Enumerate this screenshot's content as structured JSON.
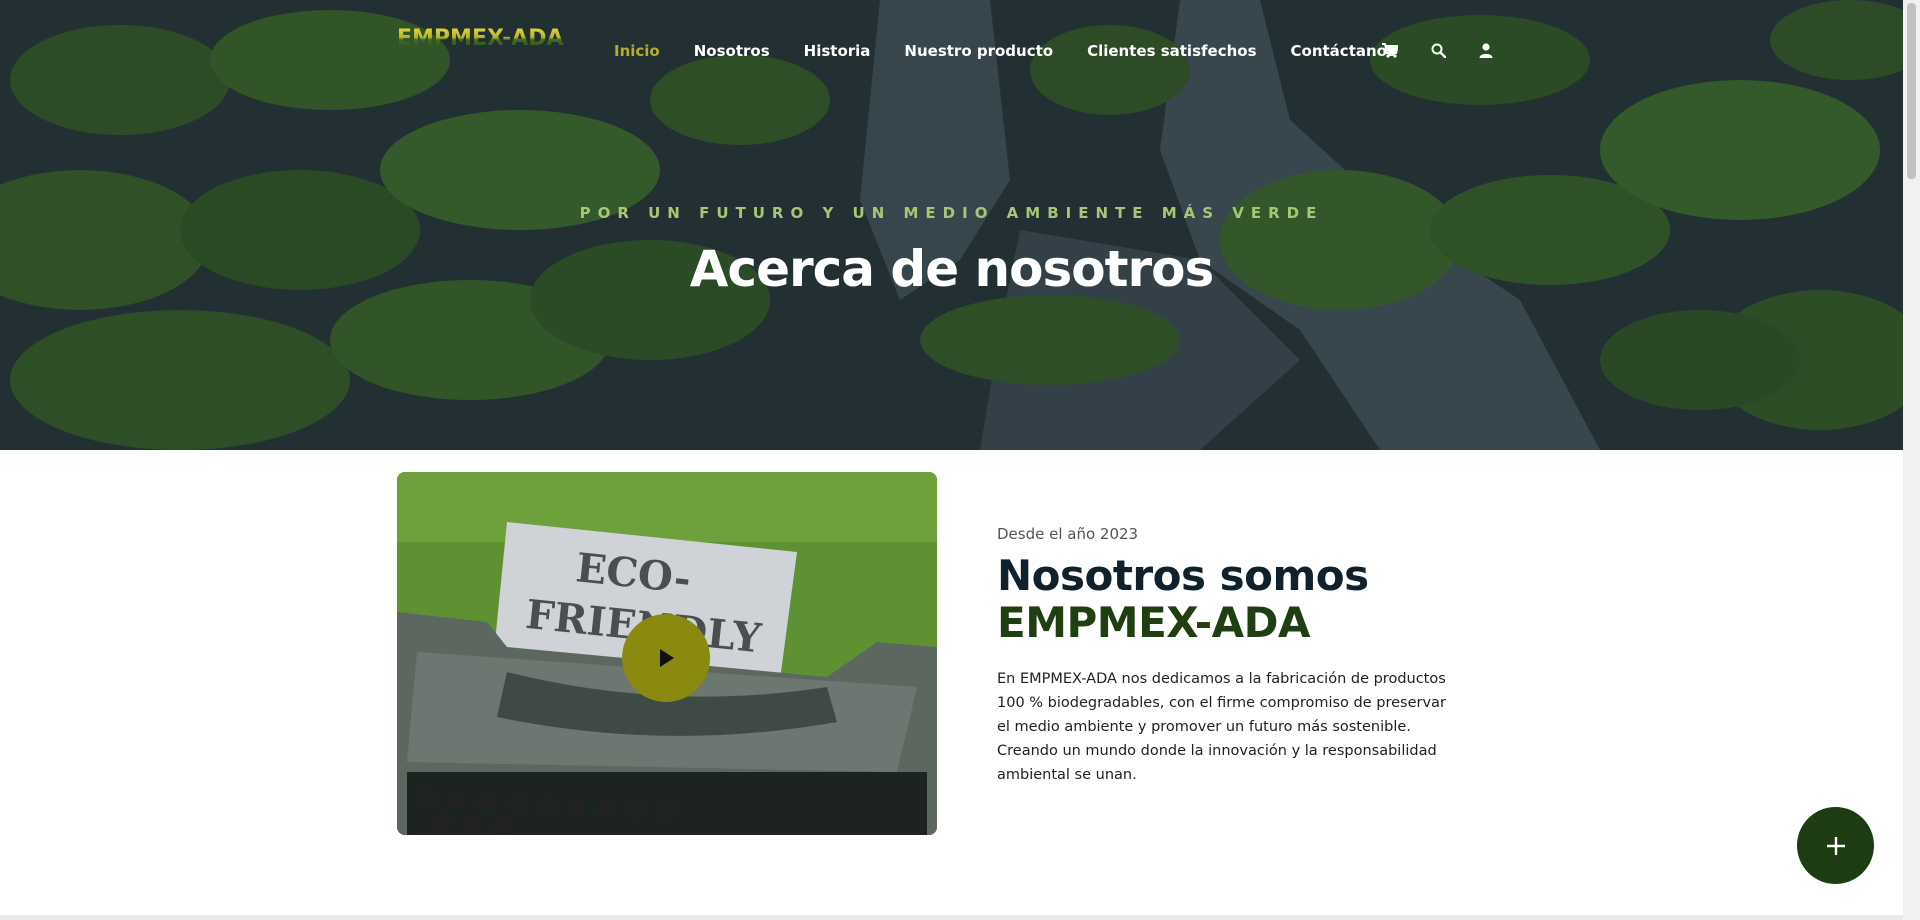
{
  "brand": {
    "logo_text": "EMPMEX-ADA"
  },
  "nav": {
    "items": [
      {
        "label": "Inicio",
        "active": true
      },
      {
        "label": "Nosotros"
      },
      {
        "label": "Historia"
      },
      {
        "label": "Nuestro producto"
      },
      {
        "label": "Clientes satisfechos"
      },
      {
        "label": "Contáctanos"
      }
    ],
    "icons": [
      "cart-icon",
      "search-icon",
      "user-icon"
    ]
  },
  "hero": {
    "kicker": "POR UN FUTURO Y UN MEDIO AMBIENTE MÁS VERDE",
    "title": "Acerca de nosotros"
  },
  "about": {
    "since": "Desde el año 2023",
    "heading_line1": "Nosotros somos",
    "heading_brand": "EMPMEX-ADA",
    "paragraph": "En EMPMEX-ADA nos dedicamos a la fabricación de productos 100 % biodegradables, con el firme compromiso de preservar el medio ambiente y promover un futuro más sostenible. Creando un mundo donde la innovación y la responsabilidad ambiental se unan.",
    "image_text_line1": "ECO-",
    "image_text_line2": "FRIENDLY"
  },
  "colors": {
    "accent": "#b7ad2a",
    "brand_green": "#1f3f12",
    "fab": "#1e3c14",
    "play": "#8a8a10",
    "kicker": "#a7c774"
  }
}
